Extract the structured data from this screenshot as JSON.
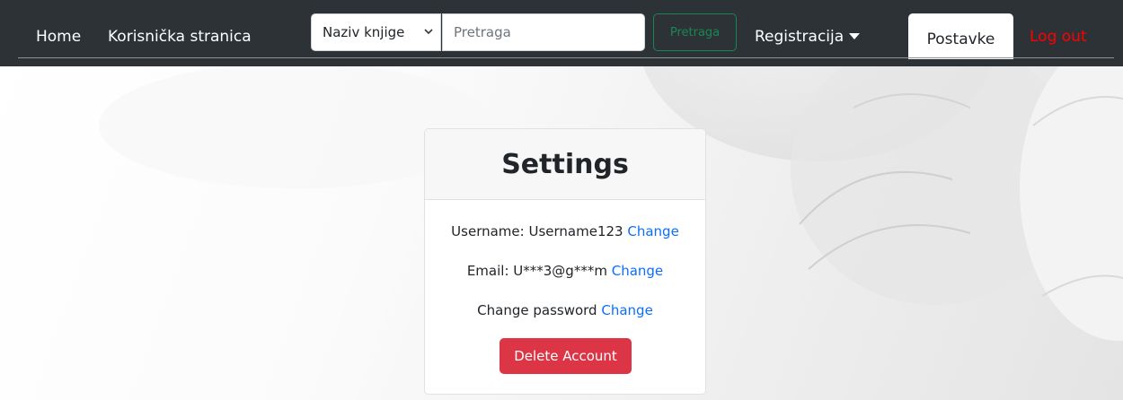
{
  "navbar": {
    "home": "Home",
    "user_page": "Korisnička stranica",
    "search": {
      "select_value": "Naziv knjige",
      "placeholder": "Pretraga",
      "button": "Pretraga"
    },
    "register": "Registracija",
    "settings": "Postavke",
    "logout": "Log out"
  },
  "settings": {
    "title": "Settings",
    "username_label": "Username:",
    "username_value": "Username123",
    "email_label": "Email:",
    "email_value": "U***3@g***m",
    "password_label": "Change password",
    "change_link": "Change",
    "delete_button": "Delete Account"
  },
  "colors": {
    "navbar_bg": "#2d3237",
    "link_blue": "#0d6efd",
    "logout_red": "#ff0000",
    "delete_red": "#dc3545",
    "search_green": "#198754"
  }
}
